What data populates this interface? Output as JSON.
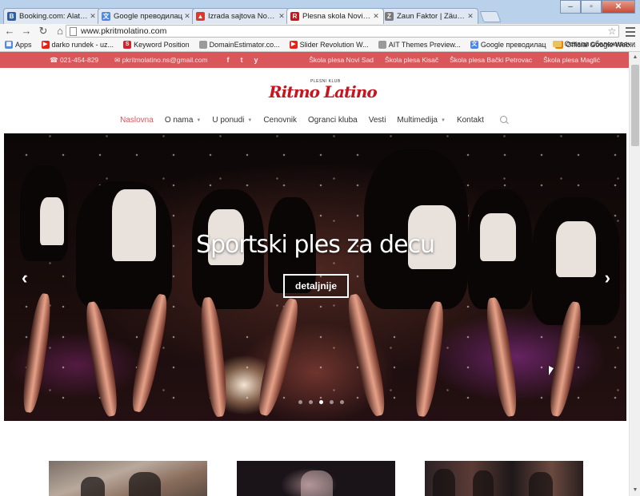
{
  "browser": {
    "tabs": [
      {
        "title": "Booking.com: Alatka za pr",
        "icon": "booking-b",
        "icon_color": "#2d5ea8",
        "active": false
      },
      {
        "title": "Google преводилац",
        "icon": "translate",
        "icon_color": "#4a86e8",
        "active": false
      },
      {
        "title": "Izrada sajtova Novi Sad | Iz",
        "icon": "warning-triangle",
        "icon_color": "#d93a2b",
        "active": false
      },
      {
        "title": "Plesna skola Novi Sad | Rit",
        "icon": "ritmo",
        "icon_color": "#c8141c",
        "active": true
      },
      {
        "title": "Zaun Faktor | Zäune und T",
        "icon": "fence",
        "icon_color": "#7a7a7a",
        "active": false
      }
    ],
    "url": "www.pkritmolatino.com",
    "bookmarks": [
      {
        "label": "Apps",
        "icon_color": "#5a8ad6"
      },
      {
        "label": "darko rundek - uz...",
        "icon_color": "#e62117"
      },
      {
        "label": "Keyword Position",
        "icon_color": "#d2232a"
      },
      {
        "label": "DomainEstimator.co...",
        "icon_color": "#9a9a9a"
      },
      {
        "label": "Slider Revolution W...",
        "icon_color": "#e62117"
      },
      {
        "label": "AIT Themes Preview...",
        "icon_color": "#9a9a9a"
      },
      {
        "label": "Google преводилац",
        "icon_color": "#4a86e8"
      },
      {
        "label": "Official Google Web...",
        "icon_color": "#f57d00"
      }
    ],
    "other_bookmarks": "Остали обележивачи"
  },
  "site": {
    "topbar": {
      "phone": "021-454-829",
      "email": "pkritmolatino.ns@gmail.com",
      "social": [
        "f",
        "t",
        "y"
      ],
      "schools": [
        "Škola plesa Novi Sad",
        "Škola plesa Kisač",
        "Škola plesa Bački Petrovac",
        "Škola plesa Maglić"
      ]
    },
    "logo": {
      "tagline": "PLESNI KLUB",
      "wordmark": "Ritmo Latino"
    },
    "nav": [
      {
        "label": "Naslovna",
        "active": true,
        "dropdown": false
      },
      {
        "label": "O nama",
        "active": false,
        "dropdown": true
      },
      {
        "label": "U ponudi",
        "active": false,
        "dropdown": true
      },
      {
        "label": "Cenovnik",
        "active": false,
        "dropdown": false
      },
      {
        "label": "Ogranci kluba",
        "active": false,
        "dropdown": false
      },
      {
        "label": "Vesti",
        "active": false,
        "dropdown": false
      },
      {
        "label": "Multimedija",
        "active": false,
        "dropdown": true
      },
      {
        "label": "Kontakt",
        "active": false,
        "dropdown": false
      }
    ],
    "hero": {
      "title": "Sportski ples za decu",
      "button_label": "detaljnije",
      "prev_arrow": "‹",
      "next_arrow": "›",
      "slide_count": 5,
      "active_slide": 3
    }
  },
  "colors": {
    "brand_red": "#d9575a",
    "logo_red": "#c8141c"
  }
}
